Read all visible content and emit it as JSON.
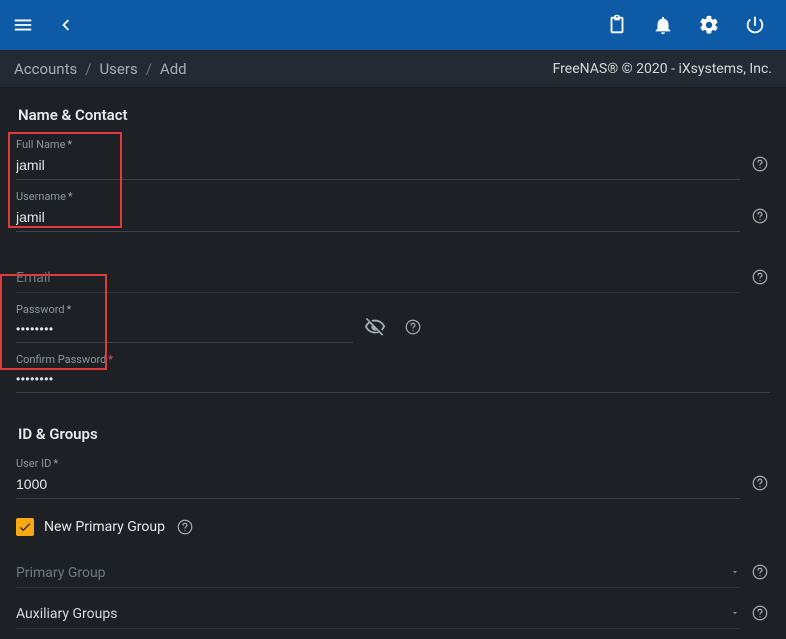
{
  "breadcrumb": {
    "accounts": "Accounts",
    "users": "Users",
    "add": "Add"
  },
  "copyright": "FreeNAS® © 2020 - iXsystems, Inc.",
  "sections": {
    "name_contact": {
      "title": "Name & Contact",
      "full_name_label": "Full Name",
      "full_name_value": "jamil",
      "username_label": "Username",
      "username_value": "jamil",
      "email_label": "Email",
      "email_value": "",
      "password_label": "Password",
      "password_value": "••••••••",
      "confirm_password_label": "Confirm Password",
      "confirm_password_value": "••••••••"
    },
    "id_groups": {
      "title": "ID & Groups",
      "user_id_label": "User ID",
      "user_id_value": "1000",
      "new_primary_group_label": "New Primary Group",
      "new_primary_group_checked": true,
      "primary_group_label": "Primary Group",
      "auxiliary_groups_label": "Auxiliary Groups"
    }
  }
}
